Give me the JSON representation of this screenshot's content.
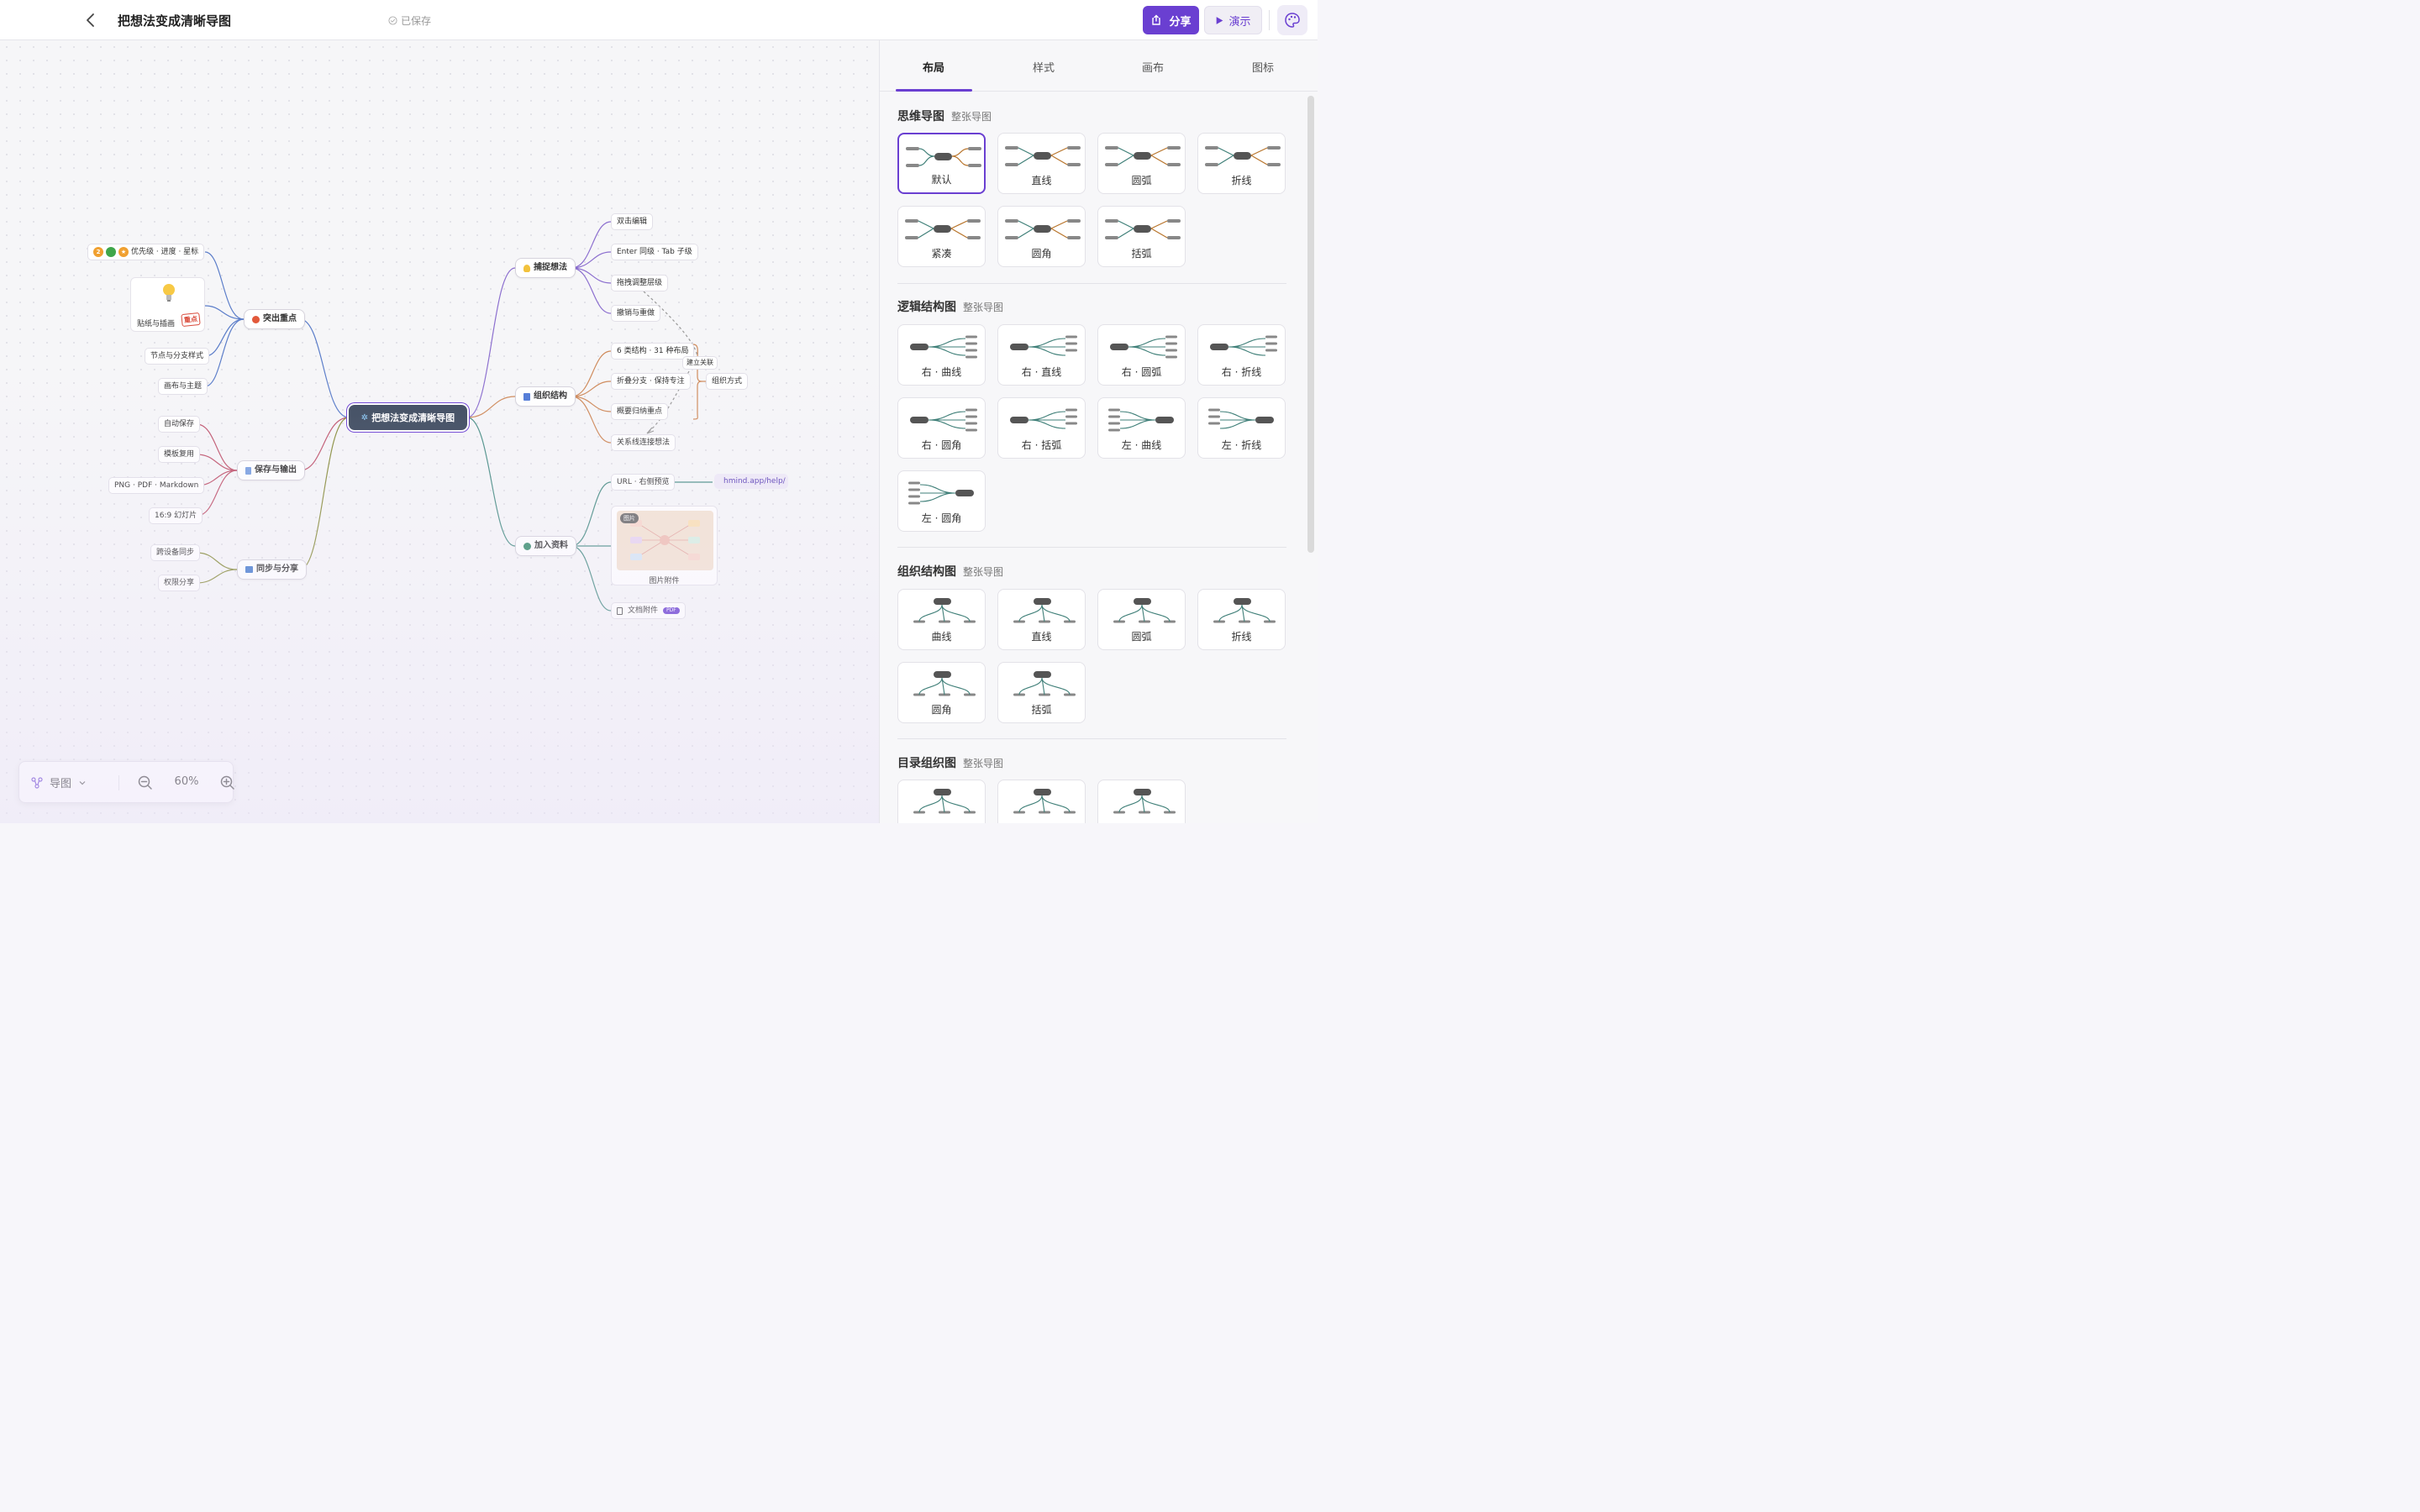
{
  "topbar": {
    "back_icon": "chevron-left-icon",
    "title": "把想法变成清晰导图",
    "saved": "已保存",
    "share": "分享",
    "present": "演示",
    "theme_icon": "palette-icon"
  },
  "mindmap": {
    "root": "把想法变成清晰导图",
    "left": [
      {
        "label": "突出重点",
        "color": "#5b7dc9",
        "children": [
          "优先级 · 进度 · 星标",
          "贴纸与插画",
          "节点与分支样式",
          "画布与主题"
        ],
        "badge_num": "2",
        "sticker_badge": "重点"
      },
      {
        "label": "保存与输出",
        "color": "#c0566e",
        "children": [
          "自动保存",
          "模板复用",
          "PNG · PDF · Markdown",
          "16:9 幻灯片"
        ]
      },
      {
        "label": "同步与分享",
        "color": "#8a8f3e",
        "children": [
          "跨设备同步",
          "权限分享"
        ]
      }
    ],
    "right": [
      {
        "label": "捕捉想法",
        "color": "#8c6fcf",
        "children": [
          "双击编辑",
          "Enter 同级 · Tab 子级",
          "拖拽调整层级",
          "撤销与重做"
        ]
      },
      {
        "label": "组织结构",
        "color": "#cf8a5a",
        "children": [
          "6 类结构 · 31 种布局",
          "折叠分支 · 保持专注",
          "概要归纳重点",
          "关系线连接想法"
        ],
        "relation": "建立关联",
        "summary": "组织方式"
      },
      {
        "label": "加入资料",
        "color": "#4a8f86",
        "children": [
          "URL · 右侧预览",
          "图片附件",
          "文档附件"
        ],
        "link": "hmind.app/help/",
        "image_tag": "图片",
        "pdf_tag": "PDF"
      }
    ]
  },
  "zoombar": {
    "mode": "导图",
    "zoom": "60%"
  },
  "panel": {
    "tabs": [
      "布局",
      "样式",
      "画布",
      "图标"
    ],
    "active_tab": "布局",
    "sections": [
      {
        "title": "思维导图",
        "sub": "整张导图",
        "items": [
          "默认",
          "直线",
          "圆弧",
          "折线",
          "紧凑",
          "圆角",
          "括弧"
        ]
      },
      {
        "title": "逻辑结构图",
        "sub": "整张导图",
        "items": [
          "右 · 曲线",
          "右 · 直线",
          "右 · 圆弧",
          "右 · 折线",
          "右 · 圆角",
          "右 · 括弧",
          "左 · 曲线",
          "左 · 折线",
          "左 · 圆角"
        ]
      },
      {
        "title": "组织结构图",
        "sub": "整张导图",
        "items": [
          "曲线",
          "直线",
          "圆弧",
          "折线",
          "圆角",
          "括弧"
        ]
      },
      {
        "title": "目录组织图",
        "sub": "整张导图",
        "items": [
          "",
          "",
          ""
        ]
      }
    ]
  },
  "colors": {
    "accent": "#6a3fd1",
    "root_bg": "#3d4a5e",
    "thumb_node": "#555555",
    "thumb_branch_a": "#3f7f78",
    "thumb_branch_b": "#b8742a"
  }
}
